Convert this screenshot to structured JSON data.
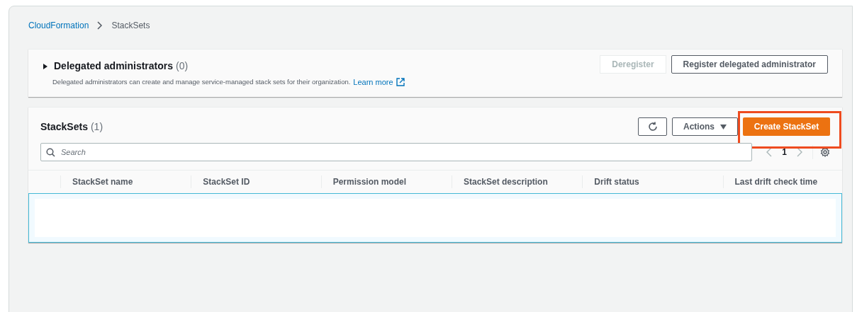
{
  "breadcrumb": [
    {
      "label": "CloudFormation",
      "kind": "link"
    },
    {
      "label": "StackSets",
      "kind": "current"
    }
  ],
  "delegated": {
    "title": "Delegated administrators",
    "count": "(0)",
    "expanded": false,
    "description": "Delegated administrators can create and manage service-managed stack sets for their organization.",
    "link": "Learn more",
    "buttons": [
      {
        "label": "Deregister",
        "disabled": true
      },
      {
        "label": "Register delegated administrator",
        "disabled": false
      }
    ]
  },
  "stacksets": {
    "title": "StackSets",
    "count": "(1)",
    "actions": "Actions",
    "create": "Create StackSet",
    "create_highlighted": true,
    "search": {
      "placeholder": "Search"
    },
    "page": "1",
    "columns": [
      "StackSet name",
      "StackSet ID",
      "Permission model",
      "StackSet description",
      "Drift status",
      "Last drift check time"
    ],
    "rows": [
      {
        "selected": true
      }
    ]
  }
}
